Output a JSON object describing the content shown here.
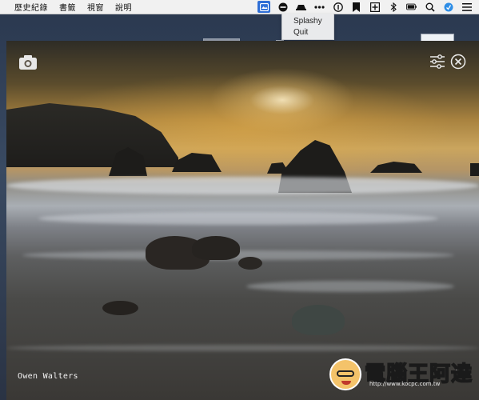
{
  "menubar": {
    "items": [
      {
        "label": "歷史紀錄"
      },
      {
        "label": "書籤"
      },
      {
        "label": "視窗"
      },
      {
        "label": "說明"
      }
    ],
    "status_icons": [
      "splashy-icon",
      "minus-circle-icon",
      "hat-icon",
      "ellipsis-icon",
      "info-circle-icon",
      "bookmark-icon",
      "plus-square-icon",
      "bluetooth-icon",
      "battery-icon",
      "search-icon",
      "blue-circle-icon",
      "list-icon"
    ]
  },
  "dropdown": {
    "items": [
      {
        "label": "Splashy"
      },
      {
        "label": "Quit"
      }
    ]
  },
  "splashy_window": {
    "photo_credit": "Owen Walters"
  },
  "watermark": {
    "text": "電腦王阿達",
    "url": "http://www.kocpc.com.tw"
  },
  "colors": {
    "accent": "#2f6fd6",
    "menubar_bg": "#f1f1f1",
    "dropdown_bg": "#e9eaec"
  }
}
